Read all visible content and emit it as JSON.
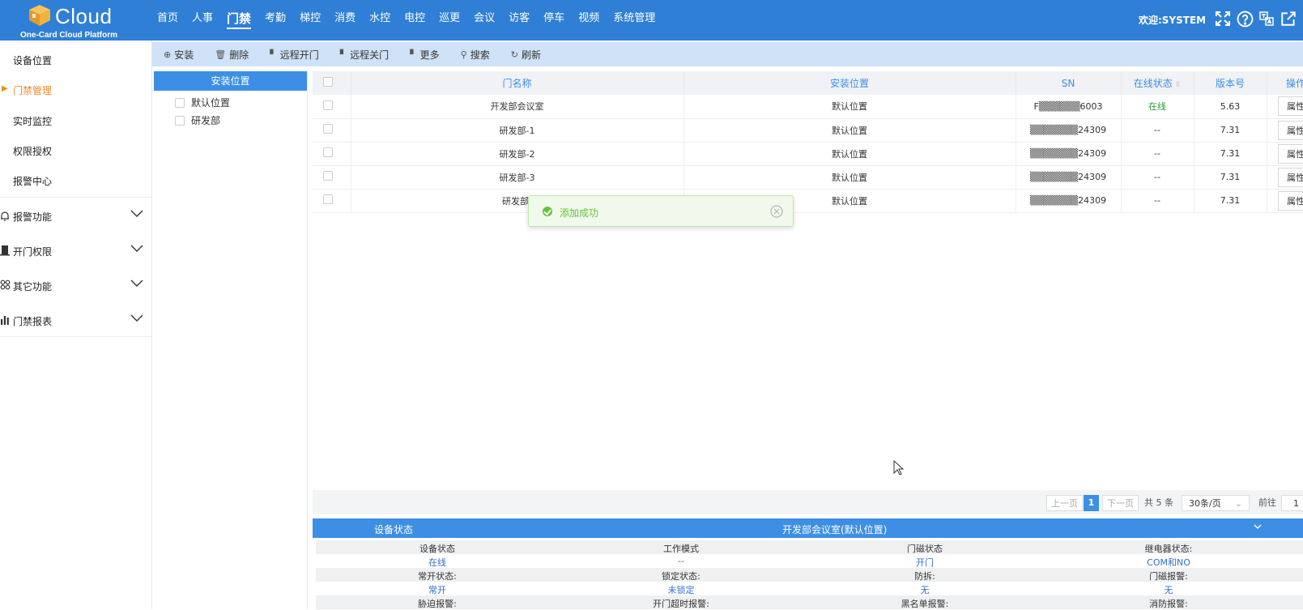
{
  "header": {
    "logo_word": "Cloud",
    "logo_sub": "One-Card Cloud Platform",
    "nav": [
      "首页",
      "人事",
      "门禁",
      "考勤",
      "梯控",
      "消费",
      "水控",
      "电控",
      "巡更",
      "会议",
      "访客",
      "停车",
      "视频",
      "系统管理"
    ],
    "active_nav": "门禁",
    "welcome": "欢迎:SYSTEM"
  },
  "sidebar": {
    "items": [
      "设备位置",
      "门禁管理",
      "实时监控",
      "权限授权",
      "报警中心"
    ],
    "active": "门禁管理",
    "groups": [
      "报警功能",
      "开门权限",
      "其它功能",
      "门禁报表"
    ]
  },
  "toolbar": {
    "install": "安装",
    "delete": "删除",
    "remote_open": "远程开门",
    "remote_close": "远程关门",
    "more": "更多",
    "search": "搜索",
    "refresh": "刷新"
  },
  "locations": {
    "title": "安装位置",
    "items": [
      "默认位置",
      "研发部"
    ]
  },
  "table": {
    "headers": [
      "门名称",
      "安装位置",
      "SN",
      "在线状态",
      "版本号",
      "操作"
    ],
    "rows": [
      {
        "name": "开发部会议室",
        "location": "默认位置",
        "sn": "F▒▒▒▒▒▒6003",
        "status": "在线",
        "version": "5.63",
        "action": "属性"
      },
      {
        "name": "研发部-1",
        "location": "默认位置",
        "sn": "▒▒▒▒▒▒▒24309",
        "status": "--",
        "version": "7.31",
        "action": "属性"
      },
      {
        "name": "研发部-2",
        "location": "默认位置",
        "sn": "▒▒▒▒▒▒▒24309",
        "status": "--",
        "version": "7.31",
        "action": "属性"
      },
      {
        "name": "研发部-3",
        "location": "默认位置",
        "sn": "▒▒▒▒▒▒▒24309",
        "status": "--",
        "version": "7.31",
        "action": "属性"
      },
      {
        "name": "研发部-",
        "location": "默认位置",
        "sn": "▒▒▒▒▒▒▒24309",
        "status": "--",
        "version": "7.31",
        "action": "属性"
      }
    ]
  },
  "toast": {
    "message": "添加成功"
  },
  "pager": {
    "prev": "上一页",
    "current": "1",
    "next": "下一页",
    "total": "共 5 条",
    "page_size": "30条/页",
    "goto_label": "前往",
    "goto_value": "1"
  },
  "device_status": {
    "title": "设备状态",
    "device": "开发部会议室(默认位置)",
    "rows": [
      {
        "labels": [
          "设备状态",
          "工作模式",
          "门磁状态",
          "继电器状态:"
        ],
        "values": [
          "在线",
          "--",
          "开门",
          "COM和NO"
        ]
      },
      {
        "labels": [
          "常开状态:",
          "锁定状态:",
          "防拆:",
          "门磁报警:"
        ],
        "values": [
          "常开",
          "未锁定",
          "无",
          "无"
        ]
      },
      {
        "labels": [
          "胁迫报警:",
          "开门超时报警:",
          "黑名单报警:",
          "消防报警:"
        ]
      }
    ]
  }
}
